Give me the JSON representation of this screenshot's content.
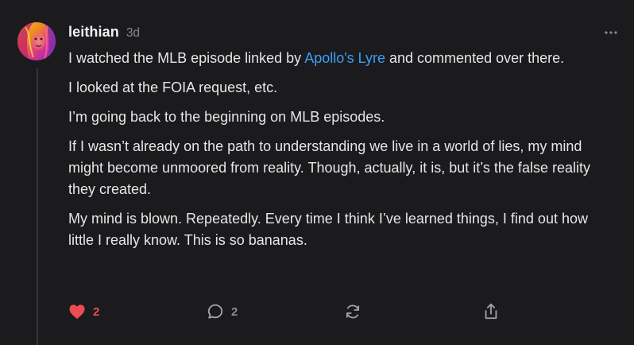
{
  "comment": {
    "author": "leithian",
    "timestamp": "3d",
    "paragraphs": [
      {
        "before": "I watched the MLB episode linked by ",
        "link": "Apollo's Lyre",
        "after": " and commented over there."
      },
      {
        "text": "I looked at the FOIA request, etc."
      },
      {
        "text": "I’m going back to the beginning on MLB episodes."
      },
      {
        "text": "If I wasn’t already on the path to understanding we live in a world of lies, my mind might become unmoored from reality. Though, actually, it is, but it’s the false reality they created."
      },
      {
        "text": "My mind is blown. Repeatedly. Every time I think I’ve learned things, I find out how little I really know. This is so bananas."
      }
    ]
  },
  "actions": {
    "like": {
      "icon": "heart-icon",
      "count": "2",
      "color": "#ec4c52",
      "active": true
    },
    "reply": {
      "icon": "comment-bubble-icon",
      "count": "2"
    },
    "restack": {
      "icon": "restack-icon"
    },
    "share": {
      "icon": "share-icon"
    }
  },
  "colors": {
    "background": "#1b1b1d",
    "text": "#e6e6e7",
    "link": "#3b9dfa",
    "muted": "#8a8a8e",
    "like": "#ec4c52"
  }
}
